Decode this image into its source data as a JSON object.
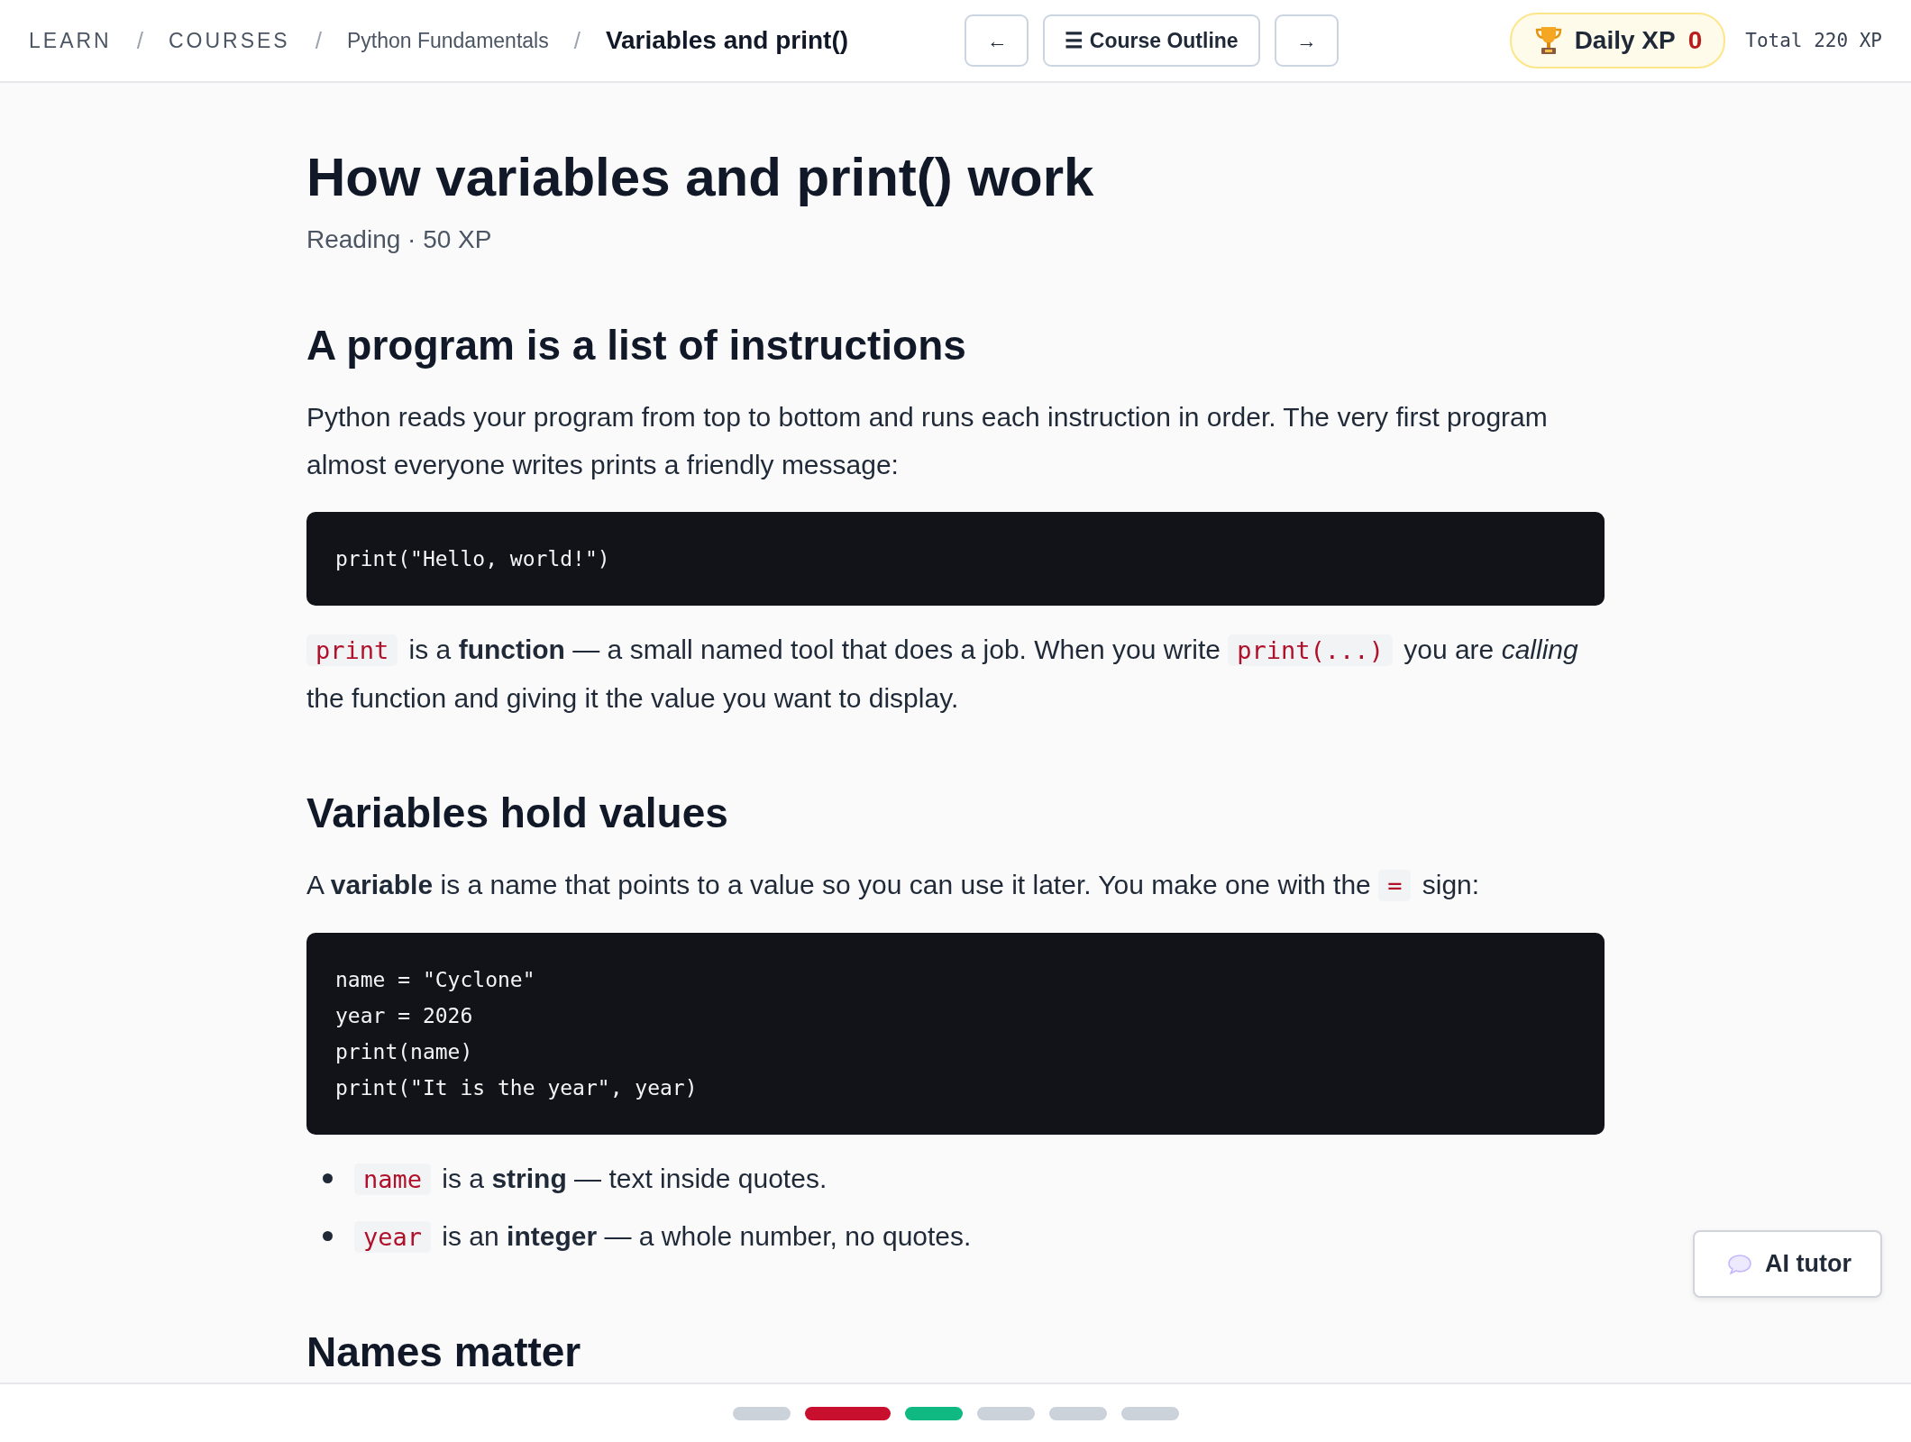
{
  "breadcrumb": [
    {
      "label": "LEARN",
      "kind": "caps",
      "current": false
    },
    {
      "label": "COURSES",
      "kind": "caps",
      "current": false
    },
    {
      "label": "Python Fundamentals",
      "kind": "plain",
      "current": false
    },
    {
      "label": "Variables and print()",
      "kind": "plain",
      "current": true
    }
  ],
  "separator": "/",
  "nav": {
    "prev": "←",
    "outline": "☰ Course Outline",
    "next": "→"
  },
  "xp": {
    "label": "Daily XP",
    "value": "0",
    "total": "Total 220 XP"
  },
  "lesson": {
    "title": "How variables and print() work",
    "meta": "Reading · 50 XP"
  },
  "blocks": [
    {
      "kind": "heading",
      "text": "A program is a list of instructions"
    },
    {
      "kind": "paragraph",
      "parts": [
        {
          "kind": "text",
          "text": "Python reads your program from top to bottom and runs each instruction in order. The very first program almost everyone writes prints a friendly message:"
        }
      ]
    },
    {
      "kind": "code",
      "lines": [
        "print(\"Hello, world!\")"
      ]
    },
    {
      "kind": "paragraph",
      "parts": [
        {
          "kind": "code",
          "text": "print"
        },
        {
          "kind": "text",
          "text": " is a **function** — a small named tool that does a job. When you write "
        },
        {
          "kind": "code",
          "text": "print(...)"
        },
        {
          "kind": "text",
          "text": " you are *calling* the function and giving it the value you want to display."
        }
      ]
    },
    {
      "kind": "heading",
      "text": "Variables hold values"
    },
    {
      "kind": "paragraph",
      "parts": [
        {
          "kind": "text",
          "text": "A **variable** is a name that points to a value so you can use it later. You make one with the "
        },
        {
          "kind": "code",
          "text": "="
        },
        {
          "kind": "text",
          "text": " sign:"
        }
      ]
    },
    {
      "kind": "code",
      "lines": [
        "name = \"Cyclone\"",
        "year = 2026",
        "print(name)",
        "print(\"It is the year\", year)"
      ]
    },
    {
      "kind": "list",
      "items": [
        [
          {
            "kind": "code",
            "text": "name"
          },
          {
            "kind": "text",
            "text": " is a **string** — text inside quotes."
          }
        ],
        [
          {
            "kind": "code",
            "text": "year"
          },
          {
            "kind": "text",
            "text": " is an **integer** — a whole number, no quotes."
          }
        ]
      ]
    },
    {
      "kind": "heading",
      "text": "Names matter"
    }
  ],
  "tutor": {
    "label": "AI tutor"
  },
  "progress": [
    {
      "color": "#cbd2da",
      "selected": false
    },
    {
      "color": "#c8102e",
      "selected": true
    },
    {
      "color": "#10b981",
      "selected": false
    },
    {
      "color": "#cbd2da",
      "selected": false
    },
    {
      "color": "#cbd2da",
      "selected": false
    },
    {
      "color": "#cbd2da",
      "selected": false
    }
  ]
}
